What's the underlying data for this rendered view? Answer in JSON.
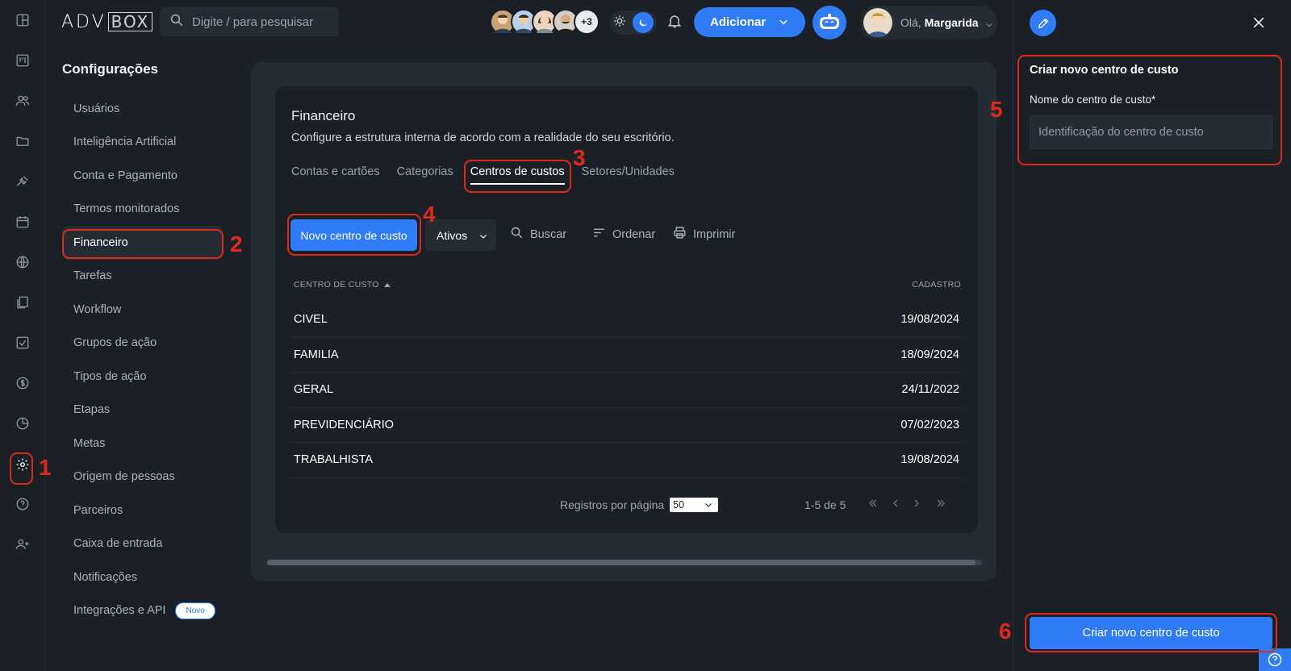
{
  "header": {
    "logo": {
      "left": "ADV",
      "boxed": "BOX"
    },
    "search_placeholder": "Digite / para pesquisar",
    "avatars_more": "+3",
    "add_button": "Adicionar",
    "user_greeting": "Olá,",
    "user_name": "Margarida"
  },
  "rail": {
    "icons": [
      "dashboard-icon",
      "kanban-icon",
      "people-icon",
      "folder-icon",
      "gavel-icon",
      "calendar-icon",
      "globe-icon",
      "documents-icon",
      "checkbox-icon",
      "dollar-icon",
      "pie-chart-icon",
      "gear-icon",
      "help-icon",
      "add-user-icon"
    ],
    "active": "gear-icon"
  },
  "settings": {
    "title": "Configurações",
    "items": [
      {
        "label": "Usuários"
      },
      {
        "label": "Inteligência Artificial"
      },
      {
        "label": "Conta e Pagamento"
      },
      {
        "label": "Termos monitorados"
      },
      {
        "label": "Financeiro"
      },
      {
        "label": "Tarefas"
      },
      {
        "label": "Workflow"
      },
      {
        "label": "Grupos de ação"
      },
      {
        "label": "Tipos de ação"
      },
      {
        "label": "Etapas"
      },
      {
        "label": "Metas"
      },
      {
        "label": "Origem de pessoas"
      },
      {
        "label": "Parceiros"
      },
      {
        "label": "Caixa de entrada"
      },
      {
        "label": "Notificações"
      },
      {
        "label": "Integrações e API"
      }
    ],
    "active_index": 4,
    "badge_new": "Novo"
  },
  "main": {
    "title": "Financeiro",
    "subtitle": "Configure a estrutura interna de acordo com a realidade do seu escritório.",
    "tabs": [
      {
        "label": "Contas e cartões"
      },
      {
        "label": "Categorias"
      },
      {
        "label": "Centros de custos"
      },
      {
        "label": "Setores/Unidades"
      }
    ],
    "active_tab": 2,
    "new_button": "Novo centro de custo",
    "status_filter": "Ativos",
    "search_label": "Buscar",
    "sort_label": "Ordenar",
    "print_label": "Imprimir",
    "table": {
      "columns": [
        "CENTRO DE CUSTO",
        "CADASTRO"
      ],
      "rows": [
        {
          "name": "CIVEL",
          "date": "19/08/2024"
        },
        {
          "name": "FAMILIA",
          "date": "18/09/2024"
        },
        {
          "name": "GERAL",
          "date": "24/11/2022"
        },
        {
          "name": "PREVIDENCIÁRIO",
          "date": "07/02/2023"
        },
        {
          "name": "TRABALHISTA",
          "date": "19/08/2024"
        }
      ]
    },
    "pagination": {
      "per_page_label": "Registros por página",
      "per_page_value": "50",
      "range": "1-5 de 5"
    }
  },
  "drawer": {
    "form_title": "Criar novo centro de custo",
    "field_label": "Nome do centro de custo*",
    "field_placeholder": "Identificação do centro de custo",
    "field_value": "",
    "submit_label": "Criar novo centro de custo"
  },
  "annotations": [
    "1",
    "2",
    "3",
    "4",
    "5",
    "6"
  ],
  "colors": {
    "accent": "#2f7cf6",
    "annotation": "#e0281c",
    "background": "#1b2027",
    "panel": "#262c34"
  }
}
